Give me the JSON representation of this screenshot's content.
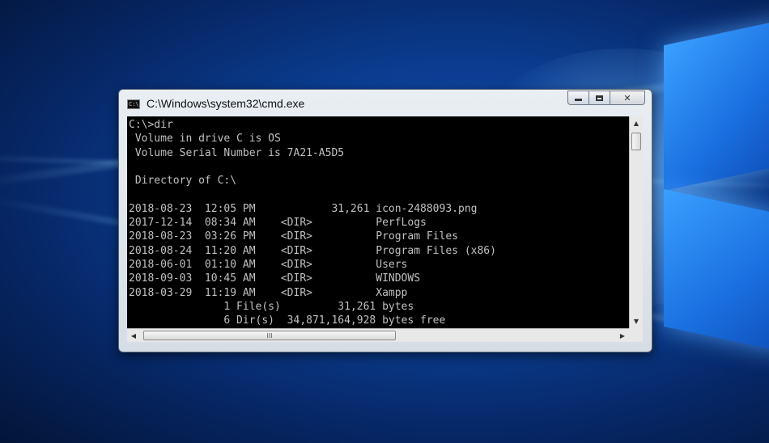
{
  "window": {
    "title": "C:\\Windows\\system32\\cmd.exe",
    "icon": "cmd-icon",
    "icon_text": "C:\\"
  },
  "controls": {
    "minimize_icon": "minimize-icon",
    "maximize_icon": "maximize-icon",
    "close_glyph": "✕"
  },
  "console": {
    "lines": [
      "C:\\>dir",
      " Volume in drive C is OS",
      " Volume Serial Number is 7A21-A5D5",
      "",
      " Directory of C:\\",
      "",
      "2018-08-23  12:05 PM            31,261 icon-2488093.png",
      "2017-12-14  08:34 AM    <DIR>          PerfLogs",
      "2018-08-23  03:26 PM    <DIR>          Program Files",
      "2018-08-24  11:20 AM    <DIR>          Program Files (x86)",
      "2018-06-01  01:10 AM    <DIR>          Users",
      "2018-09-03  10:45 AM    <DIR>          WINDOWS",
      "2018-03-29  11:19 AM    <DIR>          Xampp",
      "               1 File(s)         31,261 bytes",
      "               6 Dir(s)  34,871,164,928 bytes free"
    ]
  },
  "scrollbars": {
    "up_arrow": "▲",
    "down_arrow": "▼",
    "left_arrow": "◀",
    "right_arrow": "▶",
    "grip": "III"
  },
  "colors": {
    "console_bg": "#000000",
    "console_fg": "#c0c0c0"
  }
}
